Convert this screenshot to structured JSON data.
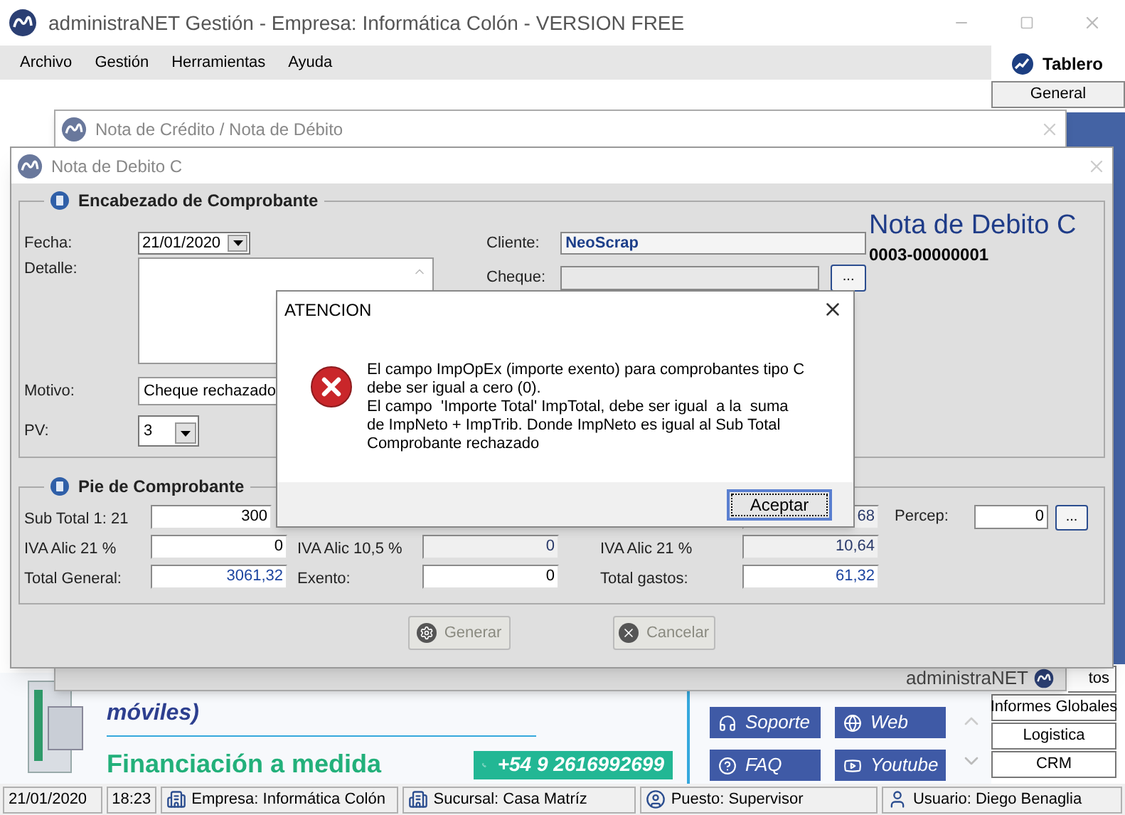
{
  "main_window": {
    "title": "administraNET Gestión - Empresa: Informática Colón - VERSION FREE",
    "menu": [
      "Archivo",
      "Gestión",
      "Herramientas",
      "Ayuda"
    ]
  },
  "tablero": {
    "title": "Tablero",
    "tab": "General"
  },
  "side_buttons": [
    {
      "label": "tos",
      "kind": "partial"
    },
    {
      "label": "Informes Globales",
      "kind": "full"
    },
    {
      "label": "Logistica",
      "kind": "full"
    },
    {
      "label": "CRM",
      "kind": "full"
    }
  ],
  "promo": {
    "heading": "móviles)",
    "subheading": "Financiación a medida",
    "phone": "+54 9 2616992699",
    "links": [
      {
        "label": "Soporte",
        "kind": "support"
      },
      {
        "label": "Web",
        "kind": "web"
      },
      {
        "label": "FAQ",
        "kind": "faq"
      },
      {
        "label": "Youtube",
        "kind": "video"
      }
    ]
  },
  "status_bar": [
    {
      "kind": "date",
      "text": "21/01/2020"
    },
    {
      "kind": "time",
      "text": "18:23"
    },
    {
      "kind": "company",
      "text": "Empresa: Informática Colón"
    },
    {
      "kind": "branch",
      "text": "Sucursal: Casa Matríz"
    },
    {
      "kind": "role",
      "text": "Puesto: Supervisor"
    },
    {
      "kind": "user",
      "text": "Usuario: Diego Benaglia"
    }
  ],
  "back_window": {
    "title": "Nota de Crédito / Nota de Débito",
    "brand": "administraNET"
  },
  "front_window": {
    "title": "Nota de Debito C",
    "header": {
      "title": "Encabezado de Comprobante",
      "fecha": {
        "label": "Fecha:",
        "value": "21/01/2020"
      },
      "detalle": {
        "label": "Detalle:"
      },
      "motivo": {
        "label": "Motivo:",
        "value": "Cheque rechazado"
      },
      "pv": {
        "label": "PV:",
        "value": "3"
      },
      "cliente": {
        "label": "Cliente:",
        "value": "NeoScrap"
      },
      "cheque": {
        "label": "Cheque:",
        "button": "..."
      },
      "doc_title": "Nota de Debito C",
      "doc_number": "0003-00000001"
    },
    "footer": {
      "title": "Pie de Comprobante",
      "col1": [
        {
          "label": "Sub Total 1: 21",
          "value": "300",
          "kind": "partial"
        },
        {
          "label": "IVA Alic 21 %",
          "value": "0",
          "kind": "input"
        },
        {
          "label": "Total General:",
          "value": "3061,32",
          "kind": "total"
        }
      ],
      "col2": [
        {
          "label": "IVA Alic 10,5 %",
          "value": "0",
          "kind": "readonly"
        },
        {
          "label": "Exento:",
          "value": "0",
          "kind": "input"
        }
      ],
      "col3": [
        {
          "value": "68",
          "kind": "readonly"
        },
        {
          "label": "IVA Alic 21 %",
          "value": "10,64",
          "kind": "readonly"
        },
        {
          "label": "Total gastos:",
          "value": "61,32",
          "kind": "total"
        }
      ],
      "percep": {
        "label": "Percep:",
        "value": "0",
        "button": "..."
      }
    },
    "buttons": [
      {
        "label": "Generar",
        "kind": "generate",
        "disabled": true
      },
      {
        "label": "Cancelar",
        "kind": "cancel",
        "disabled": true
      }
    ]
  },
  "dialog": {
    "title": "ATENCION",
    "message": [
      "El campo ImpOpEx (importe exento) para comprobantes tipo C",
      "debe ser igual a cero (0).",
      "El campo  'Importe Total' ImpTotal, debe ser igual  a la  suma",
      "de ImpNeto + ImpTrib. Donde ImpNeto es igual al Sub Total",
      "Comprobante rechazado"
    ],
    "button": "Aceptar"
  }
}
